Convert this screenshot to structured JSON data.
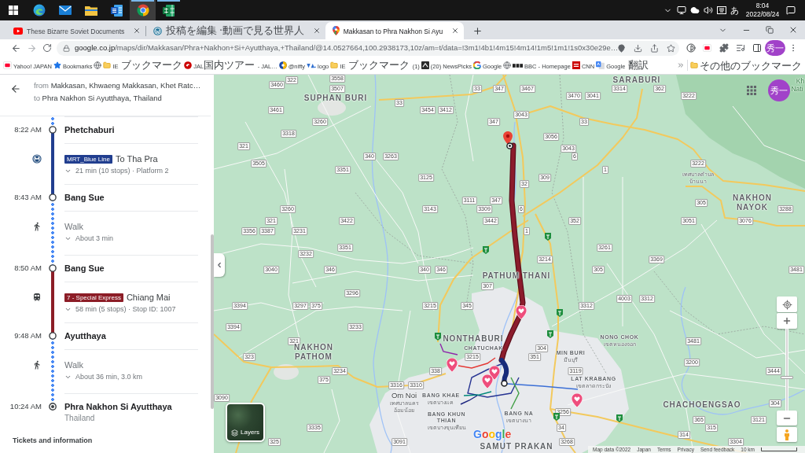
{
  "taskbar": {
    "apps": [
      {
        "selected": false,
        "running": false
      },
      {
        "selected": false,
        "running": false
      },
      {
        "selected": false,
        "running": false
      },
      {
        "selected": false,
        "running": false
      },
      {
        "selected": true,
        "running": true
      },
      {
        "selected": false,
        "running": true
      }
    ],
    "ime": "あ",
    "time": "8:04",
    "date": "2022/08/24"
  },
  "browser": {
    "tabs": [
      {
        "title": "These Bizarre Soviet Documents",
        "selected": false
      },
      {
        "title": "投稿を編集 “動画で見る世界人",
        "selected": false
      },
      {
        "title": "Makkasan to Phra Nakhon Si Ayu",
        "selected": true
      }
    ],
    "address": {
      "host": "google.co.jp",
      "path": "/maps/dir/Makkasan/Phra+Nakhon+Si+Ayutthaya,+Thailand/@14.0527664,100.2938173,10z/am=t/data=!3m1!4b1!4m15!4m14!1m5!1m1!1s0x30e29e…"
    },
    "profile": "秀一",
    "bookmarks": [
      {
        "kind": "site",
        "label": "Yahoo! JAPAN"
      },
      {
        "kind": "site",
        "label": "Bookmarks"
      },
      {
        "kind": "site"
      },
      {
        "kind": "folder",
        "label": "IE ブックマーク"
      },
      {
        "kind": "site",
        "label": "JAL国内ツアー - JAL…"
      },
      {
        "kind": "site",
        "label": "@nifty"
      },
      {
        "kind": "site",
        "label": "logo"
      },
      {
        "kind": "folder",
        "label": "IE ブックマーク (1)"
      },
      {
        "kind": "site",
        "label": "(20) NewsPicks"
      },
      {
        "kind": "site",
        "label": "Google"
      },
      {
        "kind": "site"
      },
      {
        "kind": "site",
        "label": "BBC - Homepage"
      },
      {
        "kind": "site",
        "label": "CNN"
      },
      {
        "kind": "site",
        "label": "Google 翻訳"
      }
    ],
    "other_bookmarks": "その他のブックマーク"
  },
  "directions": {
    "origin": {
      "prefix": "from",
      "place": "Makkasan, Khwaeng Makkasan, Khet Ratc…"
    },
    "destination": {
      "prefix": "to",
      "place": "Phra Nakhon Si Ayutthaya, Thailand"
    },
    "steps": [
      {
        "kind": "stop",
        "time": "8:22 AM",
        "name": "Phetchaburi"
      },
      {
        "kind": "metro",
        "line": "MRT_Blue Line",
        "color": "#213e8f",
        "headsign": "To Tha Pra",
        "details": "21 min (10 stops) · Platform 2",
        "expanded": false
      },
      {
        "kind": "stop",
        "time": "8:43 AM",
        "name": "Bang Sue"
      },
      {
        "kind": "walk",
        "label": "Walk",
        "details": "About 3 min",
        "expanded": false
      },
      {
        "kind": "stop",
        "time": "8:50 AM",
        "name": "Bang Sue"
      },
      {
        "kind": "train",
        "line": "7 - Special Express",
        "color": "#8c1d27",
        "headsign": "Chiang Mai",
        "details": "58 min (5 stops) · Stop ID: 1007",
        "expanded": false
      },
      {
        "kind": "stop",
        "time": "9:48 AM",
        "name": "Ayutthaya"
      },
      {
        "kind": "walk",
        "label": "Walk",
        "details": "About 36 min, 3.0 km",
        "expanded": false
      },
      {
        "kind": "destination",
        "time": "10:24 AM",
        "name": "Phra Nakhon Si Ayutthaya",
        "subtitle": "Thailand"
      }
    ],
    "tickets_heading": "Tickets and information"
  },
  "map": {
    "places": [
      {
        "kind": "province",
        "name": "SARABURI"
      },
      {
        "kind": "park",
        "name": "Kh"
      },
      {
        "kind": "park",
        "name": "Nati"
      },
      {
        "kind": "province",
        "name": "SUPHAN BURI"
      },
      {
        "kind": "local",
        "local": "เทศบาลตำบลบ้านนา"
      },
      {
        "kind": "province",
        "name": "NAKHON NAYOK"
      },
      {
        "kind": "province",
        "name": "PATHUM THANI"
      },
      {
        "kind": "province",
        "name": "NONTHABURI"
      },
      {
        "kind": "district",
        "name": "NONG CHOK",
        "local": "เขตหนองจอก"
      },
      {
        "kind": "province",
        "name": "NAKHON PATHOM"
      },
      {
        "kind": "district",
        "name": "CHATUCHAK"
      },
      {
        "kind": "district",
        "name": "MIN BURI",
        "local": "มีนบุรี"
      },
      {
        "kind": "district",
        "name": "LAT KRABANG",
        "local": "เขตลาดกระบัง"
      },
      {
        "kind": "town",
        "name": "Om Noi",
        "local": "เทศบาลนครอ้อมน้อย"
      },
      {
        "kind": "district",
        "name": "BANG KHAE",
        "local": "เขตบางแค"
      },
      {
        "kind": "province",
        "name": "CHACHOENGSAO"
      },
      {
        "kind": "district",
        "name": "BANG KHUN THIAN",
        "local": "เขตบางขุนเทียน"
      },
      {
        "kind": "district",
        "name": "BANG NA",
        "local": "เขตบางนา"
      },
      {
        "kind": "province",
        "name": "SAMUT PRAKAN"
      }
    ],
    "road_numbers": [
      "322",
      "3558",
      "3460",
      "3507",
      "33",
      "347",
      "3467",
      "3314",
      "362",
      "3470",
      "3041",
      "3222",
      "33",
      "3461",
      "3454",
      "3412",
      "3043",
      "3260",
      "347",
      "33",
      "3318",
      "3056",
      "321",
      "3043",
      "340",
      "3263",
      "6",
      "3505",
      "3222",
      "3351",
      "1",
      "3125",
      "309",
      "32",
      "3111",
      "347",
      "305",
      "3260",
      "3143",
      "3309",
      "6",
      "3288",
      "321",
      "3422",
      "3442",
      "352",
      "3051",
      "3076",
      "3356",
      "3387",
      "3231",
      "1",
      "3351",
      "3261",
      "3232",
      "3214",
      "3369",
      "3040",
      "346",
      "340",
      "346",
      "305",
      "3481",
      "307",
      "3296",
      "4003",
      "3312",
      "3394",
      "3297",
      "375",
      "3215",
      "345",
      "3312",
      "3394",
      "3233",
      "321",
      "3481",
      "304",
      "323",
      "3215",
      "351",
      "3200",
      "3234",
      "338",
      "3119",
      "3444",
      "375",
      "3316",
      "3310",
      "3090",
      "304",
      "3256",
      "365",
      "3121",
      "3335",
      "34",
      "315",
      "314",
      "325",
      "3091",
      "3268",
      "3304"
    ],
    "profile": "秀一",
    "zoom": {
      "level": 0.4
    },
    "layers_label": "Layers",
    "logo": "Google",
    "attribution": [
      "Map data ©2022",
      "Japan",
      "Terms",
      "Privacy",
      "Send feedback"
    ],
    "scale": "10 km"
  }
}
